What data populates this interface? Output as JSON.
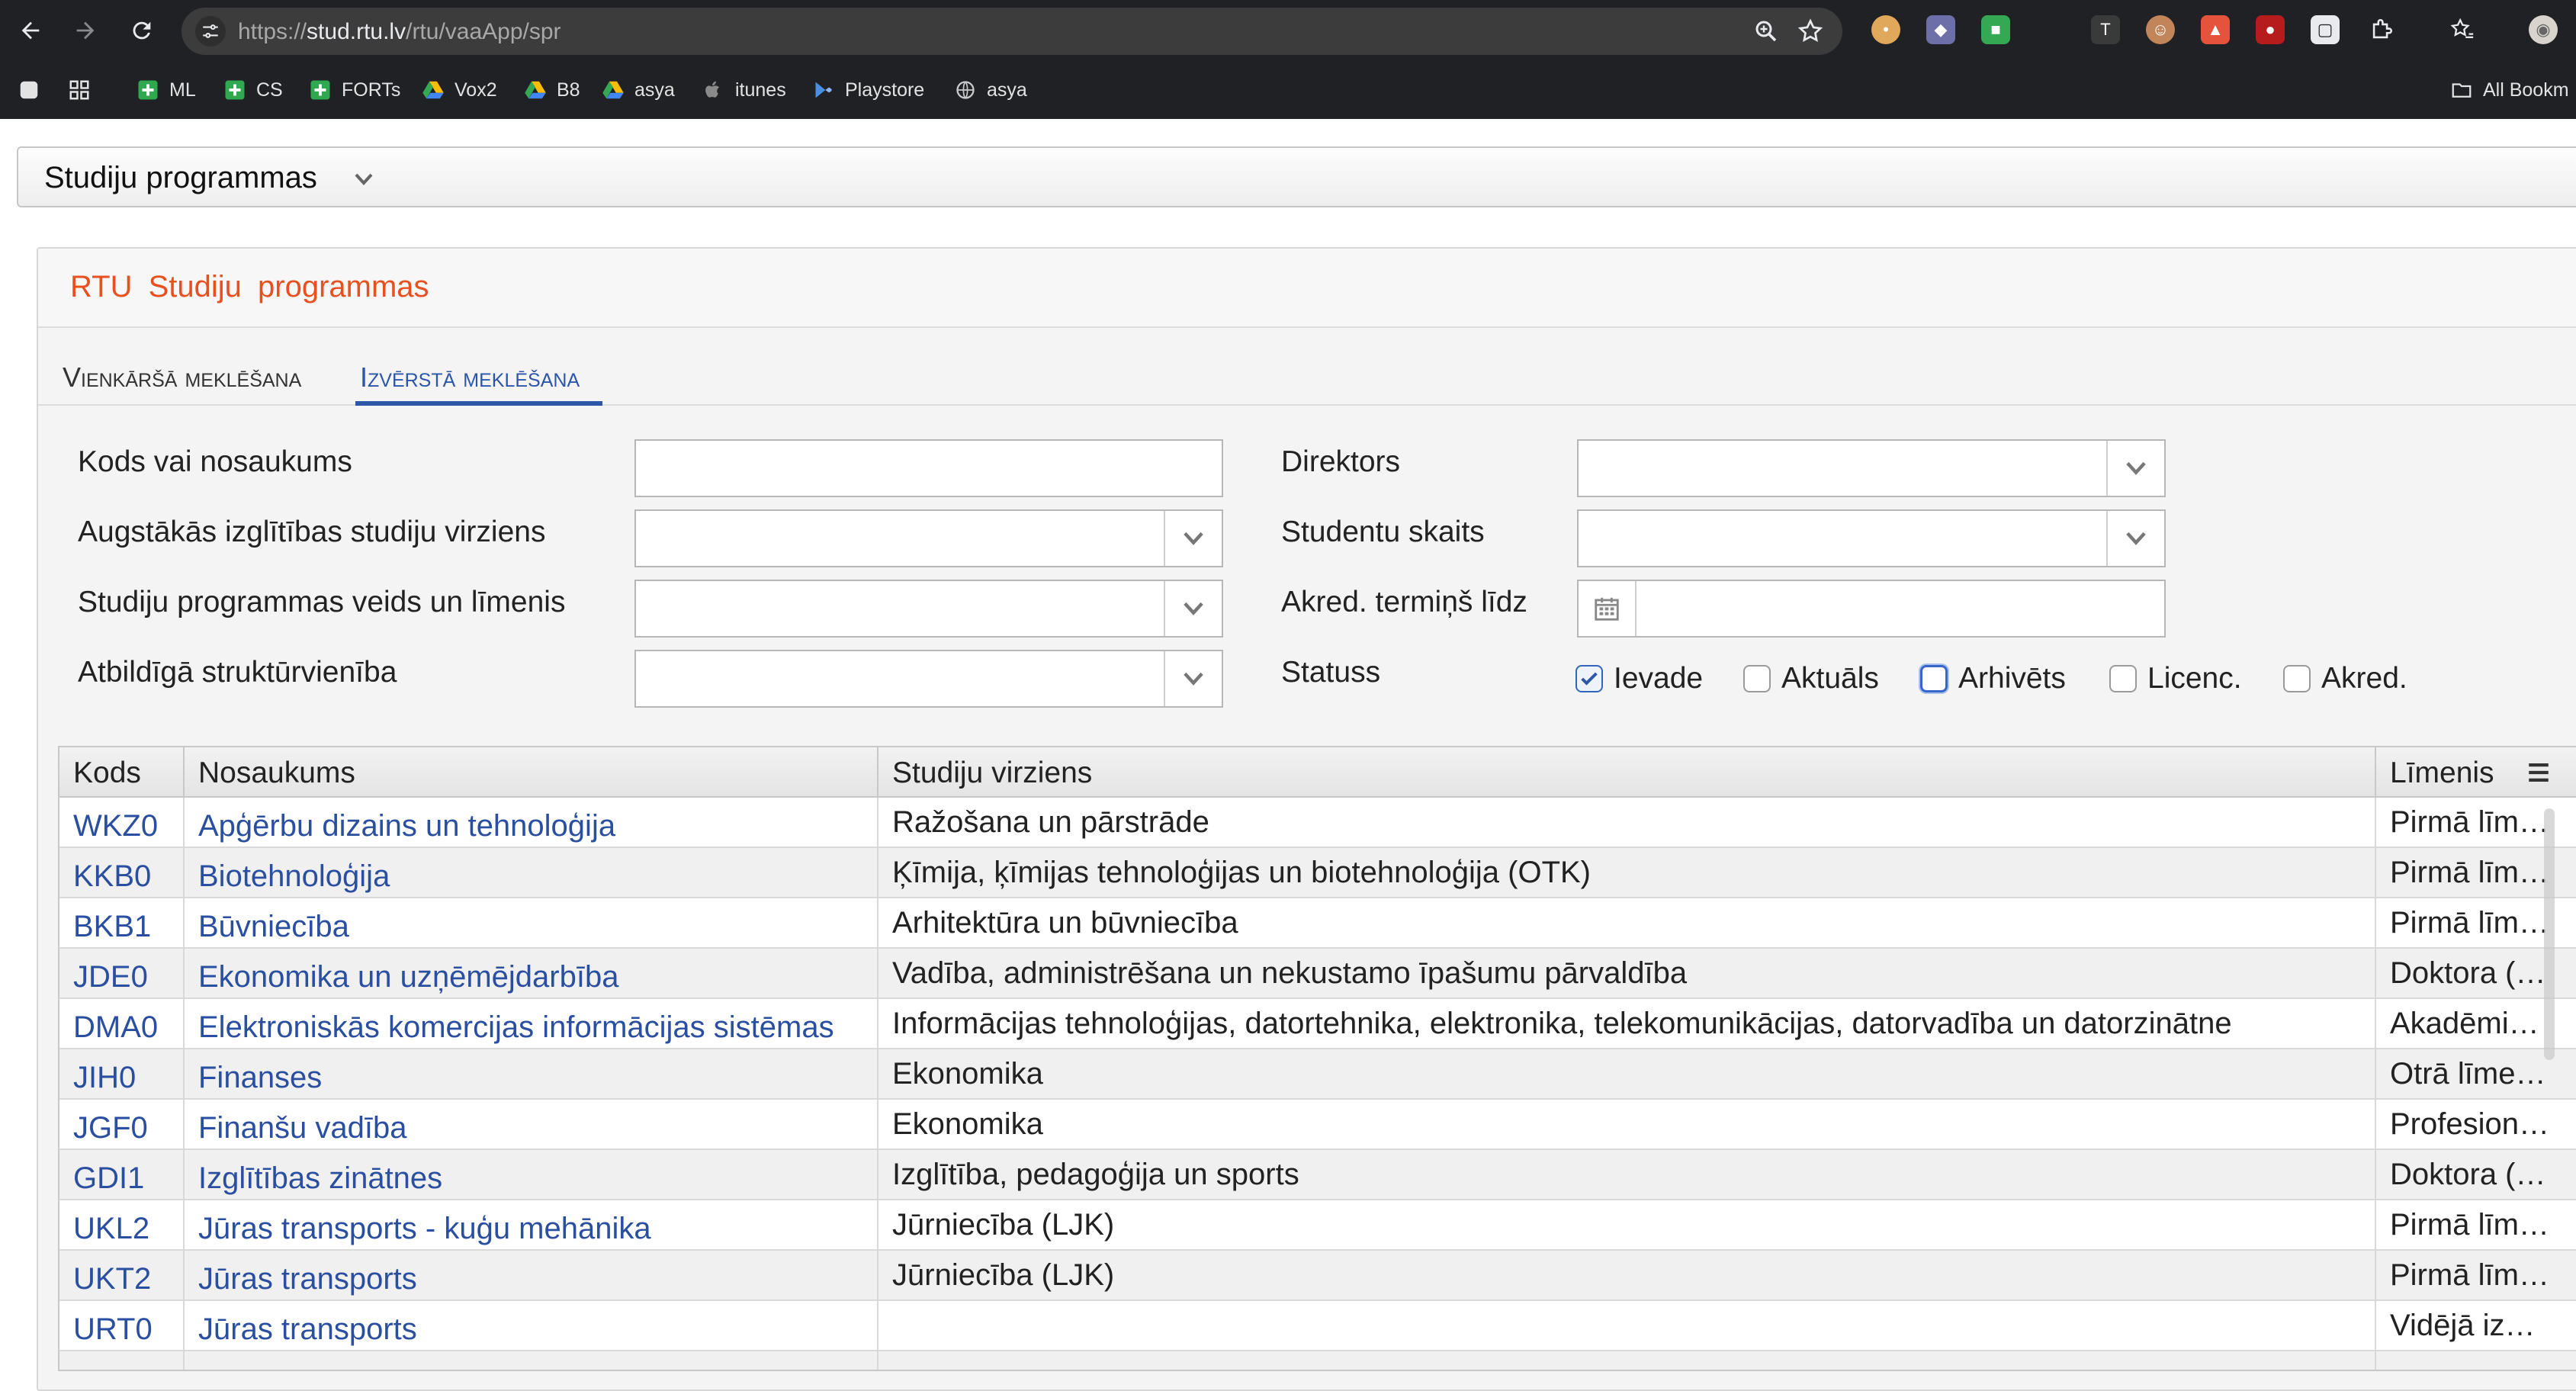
{
  "browser": {
    "url_scheme": "https://",
    "url_host": "stud.rtu.lv",
    "url_path": "/rtu/vaaApp/spr",
    "bookmarks": [
      {
        "label": "ML",
        "icon": "plus-square-icon"
      },
      {
        "label": "CS",
        "icon": "plus-square-icon"
      },
      {
        "label": "FORTs",
        "icon": "plus-square-icon"
      },
      {
        "label": "Vox2",
        "icon": "drive-icon"
      },
      {
        "label": "B8",
        "icon": "drive-icon"
      },
      {
        "label": "asya",
        "icon": "drive-icon"
      },
      {
        "label": "itunes",
        "icon": "apple-icon"
      },
      {
        "label": "Playstore",
        "icon": "playstore-icon"
      },
      {
        "label": "asya",
        "icon": "globe-icon"
      }
    ],
    "all_bookmarks_label": "All Bookm"
  },
  "page": {
    "module_title": "Studiju programmas",
    "panel_title": "RTU  Studiju  programmas",
    "tabs": [
      {
        "label": "Vienkāršā meklēšana",
        "active": false
      },
      {
        "label": "Izvērstā meklēšana",
        "active": true
      }
    ]
  },
  "filters": {
    "code_or_name_label": "Kods vai nosaukums",
    "code_or_name_value": "",
    "direction_label": "Augstākās izglītības studiju virziens",
    "type_level_label": "Studiju programmas veids un līmenis",
    "unit_label": "Atbildīgā struktūrvienība",
    "director_label": "Direktors",
    "student_count_label": "Studentu skaits",
    "accred_label": "Akred. termiņš līdz",
    "status_label": "Statuss",
    "statuses": [
      {
        "label": "Ievade",
        "checked": true
      },
      {
        "label": "Aktuāls",
        "checked": false
      },
      {
        "label": "Arhivēts",
        "checked": false,
        "focused": true
      },
      {
        "label": "Licenc.",
        "checked": false
      },
      {
        "label": "Akred.",
        "checked": false
      }
    ]
  },
  "grid": {
    "columns": [
      "Kods",
      "Nosaukums",
      "Studiju virziens",
      "Līmenis"
    ],
    "rows": [
      {
        "code": "WKZ0",
        "name": "Apģērbu dizains un tehnoloģija",
        "direction": "Ražošana un pārstrāde",
        "level": "Pirmā līmeņa profesionālās augstākās izglītības studiju programma"
      },
      {
        "code": "KKB0",
        "name": "Biotehnoloģija",
        "direction": "Ķīmija, ķīmijas tehnoloģijas un biotehnoloģija (OTK)",
        "level": "Pirmā līmeņa profesionālās augstākās izglītības studiju programma"
      },
      {
        "code": "BKB1",
        "name": "Būvniecība",
        "direction": "Arhitektūra un būvniecība",
        "level": "Pirmā līmeņa profesionālās augstākās izglītības studiju programma"
      },
      {
        "code": "JDE0",
        "name": "Ekonomika un uzņēmējdarbība",
        "direction": "Vadība, administrēšana un nekustamo īpašumu pārvaldība",
        "level": "Doktora (trešā līmeņa) studiju programma"
      },
      {
        "code": "DMA0",
        "name": "Elektroniskās komercijas informācijas sistēmas",
        "direction": "Informācijas tehnoloģijas, datortehnika, elektronika, telekomunikācijas, datorvadība un datorzinātne",
        "level": "Akadēmiskā maģistra studiju programma"
      },
      {
        "code": "JIH0",
        "name": "Finanses",
        "direction": "Ekonomika",
        "level": "Otrā līmeņa profesionālās augstākās izglītības studiju programma"
      },
      {
        "code": "JGF0",
        "name": "Finanšu vadība",
        "direction": "Ekonomika",
        "level": "Profesionālā bakalaura studiju programma"
      },
      {
        "code": "GDI1",
        "name": "Izglītības zinātnes",
        "direction": "Izglītība, pedagoģija un sports",
        "level": "Doktora (trešā līmeņa) studiju programma"
      },
      {
        "code": "UKL2",
        "name": "Jūras transports - kuģu mehānika",
        "direction": "Jūrniecība (LJK)",
        "level": "Pirmā līmeņa profesionālās augstākās izglītības studiju programma"
      },
      {
        "code": "UKT2",
        "name": "Jūras transports",
        "direction": "Jūrniecība (LJK)",
        "level": "Pirmā līmeņa profesionālās augstākās izglītības studiju programma"
      },
      {
        "code": "URT0",
        "name": "Jūras transports",
        "direction": "",
        "level": "Vidējā izglītība"
      },
      {
        "code": "",
        "name": "",
        "direction": "",
        "level": ""
      }
    ]
  }
}
